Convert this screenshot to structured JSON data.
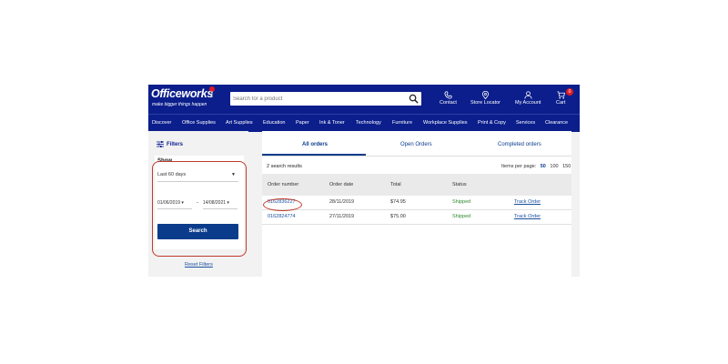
{
  "brand": {
    "name": "Officeworks",
    "tagline": "make bigger things happen"
  },
  "search": {
    "placeholder": "Search for a product"
  },
  "header_nav": [
    {
      "label": "Contact",
      "icon": "phone-icon"
    },
    {
      "label": "Store Locator",
      "icon": "location-pin-icon"
    },
    {
      "label": "My Account",
      "icon": "user-icon"
    },
    {
      "label": "Cart",
      "icon": "cart-icon",
      "badge": "0"
    }
  ],
  "categories": [
    "Discover",
    "Office Supplies",
    "Art Supplies",
    "Education",
    "Paper",
    "Ink & Toner",
    "Technology",
    "Furniture",
    "Workplace Supplies",
    "Print & Copy",
    "Services",
    "Clearance"
  ],
  "sidebar": {
    "filters_label": "Filters",
    "show_label": "Show",
    "period_value": "Last 60 days",
    "date_from": "01/06/2019",
    "date_to": "14/08/2021",
    "date_separator": "-",
    "search_button": "Search",
    "reset_label": "Reset Filters"
  },
  "tabs": [
    {
      "label": "All orders",
      "active": true
    },
    {
      "label": "Open Orders",
      "active": false
    },
    {
      "label": "Completed orders",
      "active": false
    }
  ],
  "results_summary": "2 search results",
  "per_page": {
    "label": "Items per page:",
    "options": [
      "50",
      "100",
      "150"
    ],
    "selected": "50"
  },
  "table": {
    "headers": [
      "Order number",
      "Order date",
      "Total",
      "Status"
    ],
    "rows": [
      {
        "order_number": "0162836227",
        "order_date": "28/11/2019",
        "total": "$74.95",
        "status": "Shipped",
        "action": "Track Order"
      },
      {
        "order_number": "0162824774",
        "order_date": "27/11/2019",
        "total": "$75.00",
        "status": "Shipped",
        "action": "Track Order"
      }
    ]
  },
  "colors": {
    "brand_blue": "#0b1e8c",
    "button_blue": "#0b3c8c",
    "link_blue": "#1a4fa0",
    "shipped_green": "#2e8b2e",
    "annotation_red": "#c0392b",
    "badge_red": "#e01a22"
  }
}
